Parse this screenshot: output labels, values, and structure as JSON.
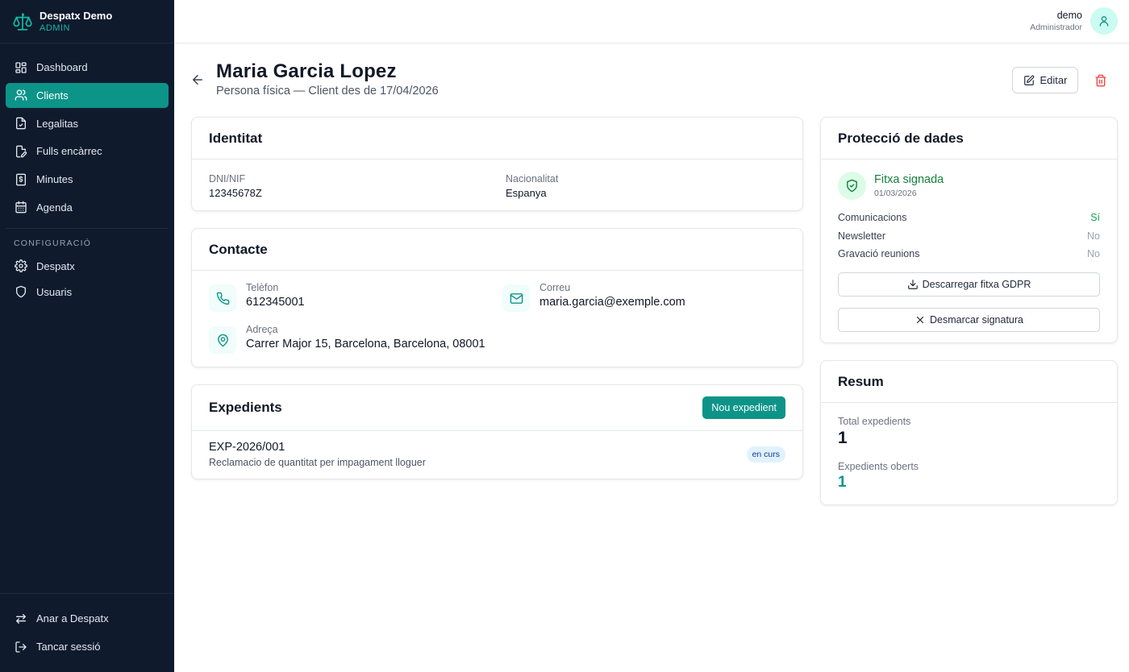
{
  "brand": {
    "title": "Despatx Demo",
    "subtitle": "ADMIN",
    "icon": "scale-icon"
  },
  "sidebar": {
    "items": [
      {
        "label": "Dashboard",
        "icon": "dashboard-icon",
        "active": false
      },
      {
        "label": "Clients",
        "icon": "users-icon",
        "active": true
      },
      {
        "label": "Legalitas",
        "icon": "document-icon",
        "active": false
      },
      {
        "label": "Fulls encàrrec",
        "icon": "file-edit-icon",
        "active": false
      },
      {
        "label": "Minutes",
        "icon": "receipt-icon",
        "active": false
      },
      {
        "label": "Agenda",
        "icon": "calendar-icon",
        "active": false
      }
    ],
    "config_heading": "CONFIGURACIÓ",
    "config_items": [
      {
        "label": "Despatx",
        "icon": "gear-icon"
      },
      {
        "label": "Usuaris",
        "icon": "shield-icon"
      }
    ],
    "bottom_items": [
      {
        "label": "Anar a Despatx",
        "icon": "swap-icon"
      },
      {
        "label": "Tancar sessió",
        "icon": "logout-icon"
      }
    ]
  },
  "user": {
    "name": "demo",
    "role": "Administrador"
  },
  "page": {
    "title": "Maria Garcia Lopez",
    "subtitle": "Persona física — Client des de 17/04/2026",
    "edit_label": "Editar"
  },
  "identity": {
    "title": "Identitat",
    "dni_label": "DNI/NIF",
    "dni_value": "12345678Z",
    "nat_label": "Nacionalitat",
    "nat_value": "Espanya"
  },
  "contact": {
    "title": "Contacte",
    "phone_label": "Telèfon",
    "phone_value": "612345001",
    "email_label": "Correu",
    "email_value": "maria.garcia@exemple.com",
    "address_label": "Adreça",
    "address_value": "Carrer Major 15, Barcelona, Barcelona, 08001"
  },
  "expedients": {
    "title": "Expedients",
    "new_label": "Nou expedient",
    "items": [
      {
        "code": "EXP-2026/001",
        "description": "Reclamacio de quantitat per impagament lloguer",
        "status": "en curs"
      }
    ]
  },
  "gdpr": {
    "title": "Protecció de dades",
    "status": "Fitxa signada",
    "date": "01/03/2026",
    "consents": [
      {
        "label": "Comunicacions",
        "value": "Sí",
        "color": "#16a34a"
      },
      {
        "label": "Newsletter",
        "value": "No",
        "color": "#9ca3af"
      },
      {
        "label": "Gravació reunions",
        "value": "No",
        "color": "#9ca3af"
      }
    ],
    "download_label": "Descarregar fitxa GDPR",
    "unmark_label": "Desmarcar signatura"
  },
  "summary": {
    "title": "Resum",
    "total_label": "Total expedients",
    "total_value": "1",
    "open_label": "Expedients oberts",
    "open_value": "1"
  },
  "colors": {
    "accent": "#0d9488",
    "sidebar_bg": "#0f1b2d",
    "danger": "#ef4444",
    "success": "#15803d"
  }
}
